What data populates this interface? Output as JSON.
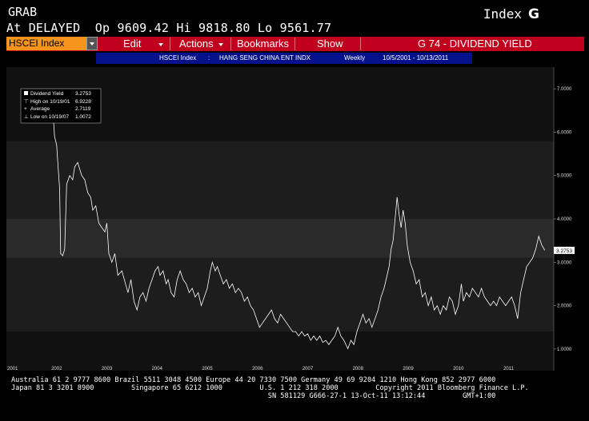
{
  "header": {
    "function": "GRAB",
    "mode": "Index",
    "mode_key": "G",
    "status": "At DELAYED",
    "open_label": "Op",
    "open": "9609.42",
    "high_label": "Hi",
    "high": "9818.80",
    "low_label": "Lo",
    "low": "9561.77"
  },
  "menubar": {
    "ticker": "HSCEI Index",
    "edit": "Edit",
    "actions": "Actions",
    "bookmarks": "Bookmarks",
    "show": "Show",
    "chart_title": "G 74 - DIVIDEND YIELD"
  },
  "subbar": {
    "ticker": "HSCEI Index",
    "sep": ":",
    "name": "HANG SENG CHINA ENT INDX",
    "period": "Weekly",
    "range": "10/5/2001 - 10/13/2011"
  },
  "legend": {
    "series": "Dividend Yield",
    "series_value": "3.2753",
    "high_label": "High on 10/19/01",
    "high_value": "6.9228",
    "avg_label": "Average",
    "avg_value": "2.7119",
    "low_label": "Low on 10/19/07",
    "low_value": "1.0072"
  },
  "colors": {
    "menubar": "#c0001d",
    "ticker_field": "#f7941d",
    "subbar": "#04118a",
    "line": "#ffffff",
    "band_dark": "#111111",
    "band_mid": "#1d1d1d",
    "band_light": "#2a2a2a"
  },
  "chart_data": {
    "type": "line",
    "series": [
      {
        "name": "Dividend Yield",
        "points": [
          [
            2001.75,
            6.9
          ],
          [
            2001.77,
            6.3
          ],
          [
            2001.8,
            6.8
          ],
          [
            2001.84,
            6.4
          ],
          [
            2001.88,
            6.8
          ],
          [
            2001.92,
            6.6
          ],
          [
            2001.96,
            5.9
          ],
          [
            2002.0,
            5.7
          ],
          [
            2002.03,
            5.2
          ],
          [
            2002.06,
            4.7
          ],
          [
            2002.08,
            3.2
          ],
          [
            2002.12,
            3.15
          ],
          [
            2002.16,
            3.3
          ],
          [
            2002.2,
            4.8
          ],
          [
            2002.26,
            5.0
          ],
          [
            2002.32,
            4.9
          ],
          [
            2002.36,
            5.2
          ],
          [
            2002.42,
            5.3
          ],
          [
            2002.5,
            5.0
          ],
          [
            2002.56,
            4.9
          ],
          [
            2002.62,
            4.6
          ],
          [
            2002.68,
            4.5
          ],
          [
            2002.72,
            4.2
          ],
          [
            2002.78,
            4.3
          ],
          [
            2002.84,
            3.9
          ],
          [
            2002.9,
            3.8
          ],
          [
            2002.96,
            3.7
          ],
          [
            2003.0,
            3.9
          ],
          [
            2003.04,
            3.2
          ],
          [
            2003.1,
            3.0
          ],
          [
            2003.16,
            3.2
          ],
          [
            2003.22,
            2.7
          ],
          [
            2003.3,
            2.8
          ],
          [
            2003.36,
            2.55
          ],
          [
            2003.42,
            2.3
          ],
          [
            2003.48,
            2.6
          ],
          [
            2003.54,
            2.1
          ],
          [
            2003.6,
            1.9
          ],
          [
            2003.66,
            2.2
          ],
          [
            2003.72,
            2.3
          ],
          [
            2003.78,
            2.1
          ],
          [
            2003.84,
            2.4
          ],
          [
            2003.9,
            2.6
          ],
          [
            2003.96,
            2.8
          ],
          [
            2004.02,
            2.9
          ],
          [
            2004.06,
            2.7
          ],
          [
            2004.12,
            2.8
          ],
          [
            2004.18,
            2.5
          ],
          [
            2004.22,
            2.6
          ],
          [
            2004.28,
            2.3
          ],
          [
            2004.34,
            2.2
          ],
          [
            2004.4,
            2.6
          ],
          [
            2004.46,
            2.8
          ],
          [
            2004.52,
            2.6
          ],
          [
            2004.58,
            2.5
          ],
          [
            2004.64,
            2.3
          ],
          [
            2004.7,
            2.4
          ],
          [
            2004.76,
            2.2
          ],
          [
            2004.82,
            2.3
          ],
          [
            2004.88,
            2.0
          ],
          [
            2004.94,
            2.2
          ],
          [
            2005.0,
            2.4
          ],
          [
            2005.06,
            2.8
          ],
          [
            2005.1,
            3.0
          ],
          [
            2005.16,
            2.8
          ],
          [
            2005.2,
            2.9
          ],
          [
            2005.26,
            2.7
          ],
          [
            2005.32,
            2.5
          ],
          [
            2005.38,
            2.6
          ],
          [
            2005.44,
            2.4
          ],
          [
            2005.5,
            2.5
          ],
          [
            2005.56,
            2.3
          ],
          [
            2005.62,
            2.4
          ],
          [
            2005.68,
            2.3
          ],
          [
            2005.74,
            2.1
          ],
          [
            2005.8,
            2.2
          ],
          [
            2005.86,
            2.0
          ],
          [
            2005.92,
            1.9
          ],
          [
            2005.98,
            1.7
          ],
          [
            2006.04,
            1.5
          ],
          [
            2006.1,
            1.6
          ],
          [
            2006.16,
            1.7
          ],
          [
            2006.22,
            1.8
          ],
          [
            2006.28,
            1.9
          ],
          [
            2006.34,
            1.7
          ],
          [
            2006.4,
            1.6
          ],
          [
            2006.46,
            1.8
          ],
          [
            2006.52,
            1.7
          ],
          [
            2006.58,
            1.6
          ],
          [
            2006.64,
            1.5
          ],
          [
            2006.7,
            1.4
          ],
          [
            2006.76,
            1.4
          ],
          [
            2006.82,
            1.3
          ],
          [
            2006.88,
            1.4
          ],
          [
            2006.94,
            1.3
          ],
          [
            2007.0,
            1.35
          ],
          [
            2007.06,
            1.2
          ],
          [
            2007.12,
            1.3
          ],
          [
            2007.18,
            1.2
          ],
          [
            2007.24,
            1.3
          ],
          [
            2007.3,
            1.15
          ],
          [
            2007.36,
            1.2
          ],
          [
            2007.42,
            1.1
          ],
          [
            2007.48,
            1.2
          ],
          [
            2007.54,
            1.3
          ],
          [
            2007.6,
            1.5
          ],
          [
            2007.66,
            1.3
          ],
          [
            2007.72,
            1.2
          ],
          [
            2007.8,
            1.0072
          ],
          [
            2007.86,
            1.2
          ],
          [
            2007.92,
            1.1
          ],
          [
            2007.98,
            1.4
          ],
          [
            2008.04,
            1.6
          ],
          [
            2008.1,
            1.8
          ],
          [
            2008.16,
            1.6
          ],
          [
            2008.22,
            1.7
          ],
          [
            2008.28,
            1.5
          ],
          [
            2008.34,
            1.7
          ],
          [
            2008.4,
            1.9
          ],
          [
            2008.46,
            2.2
          ],
          [
            2008.52,
            2.4
          ],
          [
            2008.58,
            2.7
          ],
          [
            2008.62,
            2.9
          ],
          [
            2008.66,
            3.3
          ],
          [
            2008.7,
            3.5
          ],
          [
            2008.74,
            4.0
          ],
          [
            2008.78,
            4.5
          ],
          [
            2008.82,
            4.1
          ],
          [
            2008.86,
            3.8
          ],
          [
            2008.9,
            4.2
          ],
          [
            2008.94,
            3.9
          ],
          [
            2008.98,
            3.4
          ],
          [
            2009.04,
            3.0
          ],
          [
            2009.1,
            2.8
          ],
          [
            2009.16,
            2.5
          ],
          [
            2009.22,
            2.6
          ],
          [
            2009.28,
            2.2
          ],
          [
            2009.34,
            2.3
          ],
          [
            2009.4,
            2.0
          ],
          [
            2009.46,
            2.2
          ],
          [
            2009.52,
            1.9
          ],
          [
            2009.58,
            2.0
          ],
          [
            2009.64,
            1.8
          ],
          [
            2009.7,
            2.0
          ],
          [
            2009.76,
            1.9
          ],
          [
            2009.82,
            2.2
          ],
          [
            2009.88,
            2.1
          ],
          [
            2009.94,
            1.8
          ],
          [
            2010.0,
            2.0
          ],
          [
            2010.06,
            2.5
          ],
          [
            2010.1,
            2.1
          ],
          [
            2010.16,
            2.3
          ],
          [
            2010.22,
            2.2
          ],
          [
            2010.28,
            2.4
          ],
          [
            2010.34,
            2.3
          ],
          [
            2010.4,
            2.2
          ],
          [
            2010.46,
            2.4
          ],
          [
            2010.52,
            2.2
          ],
          [
            2010.58,
            2.1
          ],
          [
            2010.64,
            2.0
          ],
          [
            2010.7,
            2.1
          ],
          [
            2010.76,
            2.0
          ],
          [
            2010.82,
            2.2
          ],
          [
            2010.88,
            2.1
          ],
          [
            2010.94,
            2.0
          ],
          [
            2011.0,
            2.1
          ],
          [
            2011.06,
            2.2
          ],
          [
            2011.12,
            2.0
          ],
          [
            2011.18,
            1.7
          ],
          [
            2011.24,
            2.3
          ],
          [
            2011.3,
            2.6
          ],
          [
            2011.36,
            2.9
          ],
          [
            2011.42,
            3.0
          ],
          [
            2011.48,
            3.1
          ],
          [
            2011.54,
            3.3
          ],
          [
            2011.6,
            3.6
          ],
          [
            2011.66,
            3.4
          ],
          [
            2011.72,
            3.2753
          ]
        ]
      }
    ],
    "ylim": [
      0.5,
      7.5
    ],
    "xlim": [
      2001.0,
      2011.9
    ],
    "yticks": [
      "1.0000",
      "2.0000",
      "3.0000",
      "4.0000",
      "5.0000",
      "6.0000",
      "7.0000"
    ],
    "ytick_values": [
      1,
      2,
      3,
      4,
      5,
      6,
      7
    ],
    "xticks": [
      "2001",
      "2002",
      "2003",
      "2004",
      "2005",
      "2006",
      "2007",
      "2008",
      "2009",
      "2010",
      "2011"
    ],
    "xtick_values": [
      2001.0,
      2002.0,
      2003.0,
      2004.0,
      2005.0,
      2006.0,
      2007.0,
      2008.0,
      2009.0,
      2010.0,
      2011.0
    ],
    "last_value_label": "3.2753",
    "last_value": 3.2753,
    "bands": [
      {
        "from": 0.5,
        "to": 1.4,
        "shade": "dark"
      },
      {
        "from": 1.4,
        "to": 3.1,
        "shade": "mid"
      },
      {
        "from": 3.1,
        "to": 4.0,
        "shade": "light"
      },
      {
        "from": 4.0,
        "to": 5.8,
        "shade": "mid"
      },
      {
        "from": 5.8,
        "to": 7.5,
        "shade": "dark"
      }
    ],
    "grid": false,
    "legend_position": "top-left"
  },
  "footer": {
    "line1": "Australia 61 2 9777 8600 Brazil 5511 3048 4500 Europe 44 20 7330 7500 Germany 49 69 9204 1210 Hong Kong 852 2977 6000",
    "line2": "Japan 81 3 3201 8900         Singapore 65 6212 1000         U.S. 1 212 318 2000         Copyright 2011 Bloomberg Finance L.P.",
    "line3": "                                                              SN 581129 G666-27-1 13-Oct-11 13:12:44         GMT+1:00"
  }
}
